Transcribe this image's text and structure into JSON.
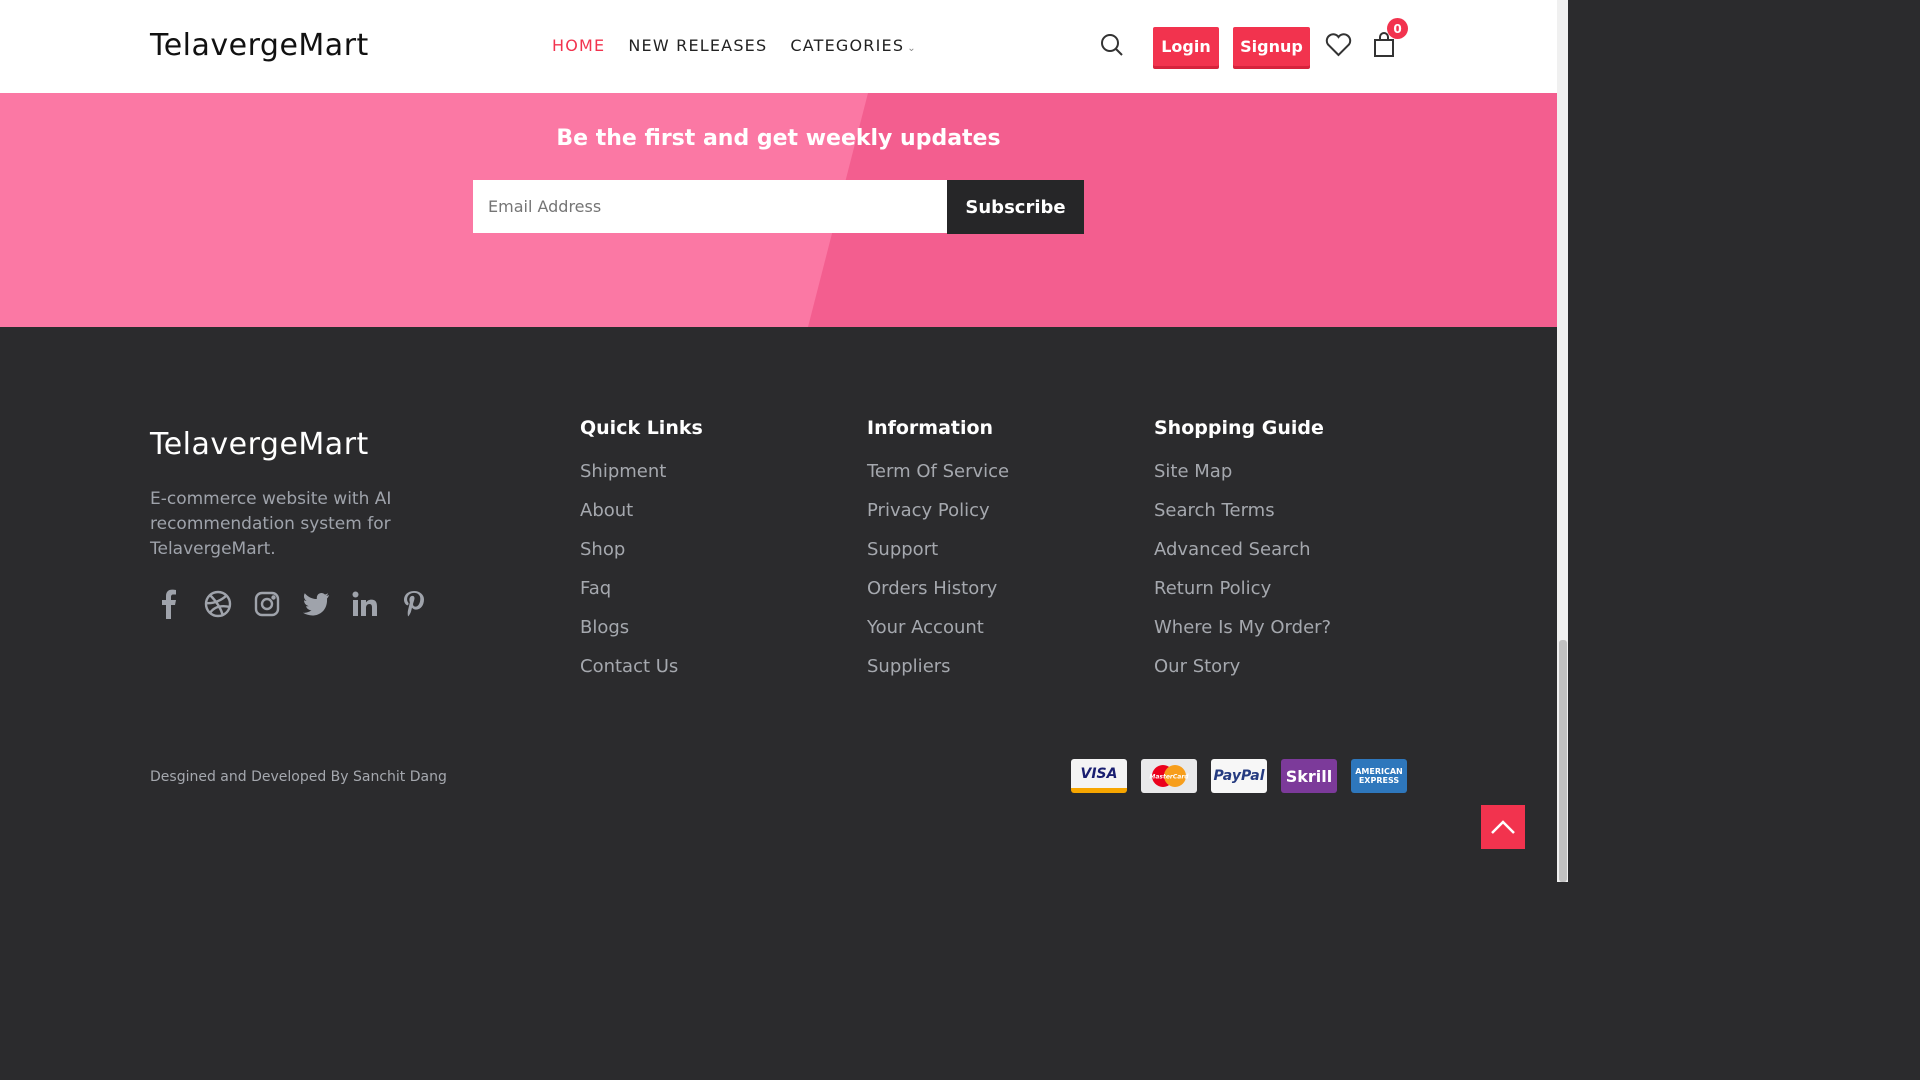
{
  "header": {
    "logo": "TelavergeMart",
    "nav": [
      "HOME",
      "NEW RELEASES",
      "CATEGORIES"
    ],
    "login": "Login",
    "signup": "Signup",
    "cart_count": "0"
  },
  "newsletter": {
    "title": "Be the first and get weekly updates",
    "email_placeholder": "Email Address",
    "subscribe": "Subscribe"
  },
  "footer": {
    "logo": "TelavergeMart",
    "about": "E-commerce website with AI recommendation system for TelavergeMart.",
    "social_icons": [
      "facebook-icon",
      "dribbble-icon",
      "instagram-icon",
      "twitter-icon",
      "linkedin-icon",
      "pinterest-icon"
    ],
    "quick_links": {
      "title": "Quick Links",
      "items": [
        "Shipment",
        "About",
        "Shop",
        "Faq",
        "Blogs",
        "Contact Us"
      ]
    },
    "information": {
      "title": "Information",
      "items": [
        "Term Of Service",
        "Privacy Policy",
        "Support",
        "Orders History",
        "Your Account",
        "Suppliers"
      ]
    },
    "shopping_guide": {
      "title": "Shopping Guide",
      "items": [
        "Site Map",
        "Search Terms",
        "Advanced Search",
        "Return Policy",
        "Where Is My Order?",
        "Our Story"
      ]
    },
    "credit": "Desgined and Developed By Sanchit Dang",
    "payments": [
      "VISA",
      "MasterCard",
      "PayPal",
      "Skrill",
      "AMERICAN EXPRESS"
    ]
  },
  "colors": {
    "accent": "#f2334e",
    "band_light": "#fb78a4",
    "band_dark": "#f35e8f",
    "footer_bg": "#2b2b2d"
  }
}
